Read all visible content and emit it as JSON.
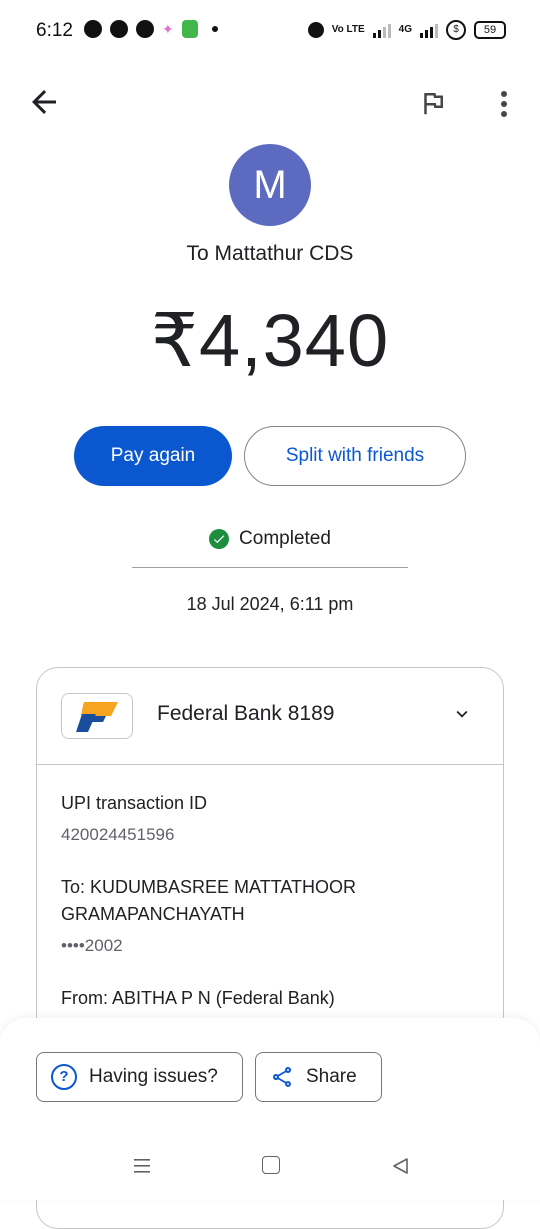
{
  "status_bar": {
    "time": "6:12",
    "network_label": "4G",
    "volte_label": "Vo LTE",
    "battery": "59"
  },
  "app_bar": {
    "back_icon": "arrow-back-icon",
    "flag_icon": "flag-icon",
    "more_icon": "more-vert-icon"
  },
  "payment": {
    "avatar_letter": "M",
    "avatar_color": "#5c6bc0",
    "recipient": "To Mattathur CDS",
    "amount": "₹4,340",
    "pay_again_label": "Pay again",
    "split_label": "Split with friends",
    "status": "Completed",
    "status_color": "#1e8e3e",
    "datetime": "18 Jul 2024, 6:11 pm"
  },
  "details": {
    "bank_name": "Federal Bank 8189",
    "upi_label": "UPI transaction ID",
    "upi_id": "420024451596",
    "to_label_line1": "To: KUDUMBASREE MATTATHOOR",
    "to_label_line2": "GRAMAPANCHAYATH",
    "to_account": "••••2002",
    "from_label": "From: ABITHA P N (Federal Bank)"
  },
  "bottom_actions": {
    "issues_label": "Having issues?",
    "share_label": "Share"
  },
  "colors": {
    "primary": "#0b57d0",
    "text": "#202124",
    "secondary_text": "#5f6368"
  }
}
